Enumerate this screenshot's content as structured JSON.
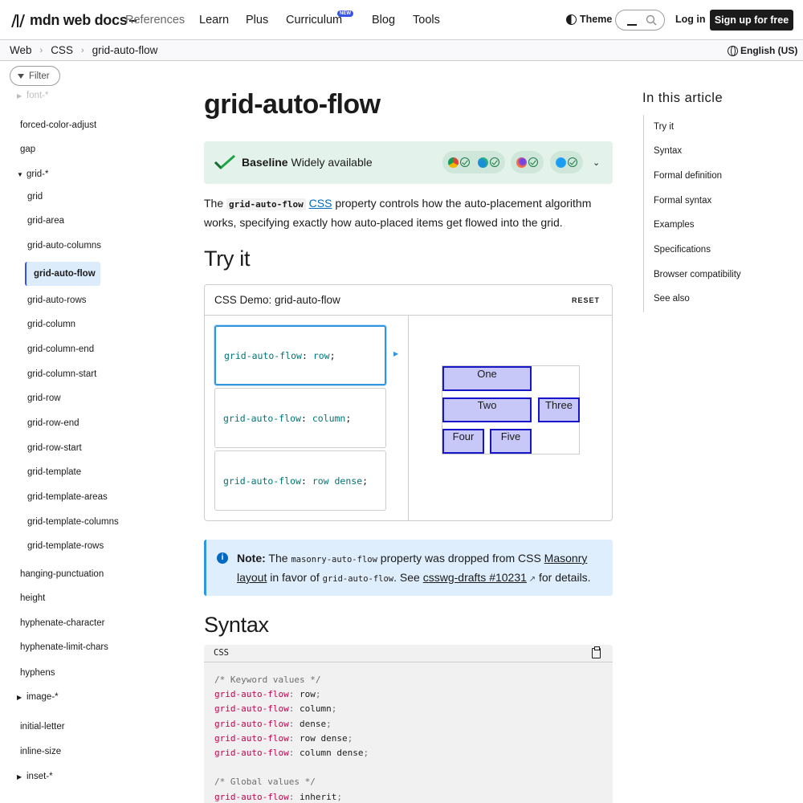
{
  "header": {
    "logo_text": "mdn web docs",
    "nav": [
      "References",
      "Learn",
      "Plus",
      "Curriculum",
      "Blog",
      "Tools"
    ],
    "new_badge": "NEW",
    "theme_label": "Theme",
    "login_label": "Log in",
    "signup_label": "Sign up for free"
  },
  "breadcrumb": {
    "items": [
      "Web",
      "CSS",
      "grid-auto-flow"
    ],
    "language": "English (US)"
  },
  "sidebar": {
    "filter_label": "Filter",
    "items": [
      {
        "label": "font-*",
        "faded": true
      },
      {
        "label": "forced-color-adjust"
      },
      {
        "label": "gap"
      },
      {
        "label": "grid-*"
      },
      {
        "label": "grid"
      },
      {
        "label": "grid-area"
      },
      {
        "label": "grid-auto-columns"
      },
      {
        "label": "grid-auto-flow",
        "active": true
      },
      {
        "label": "grid-auto-rows"
      },
      {
        "label": "grid-column"
      },
      {
        "label": "grid-column-end"
      },
      {
        "label": "grid-column-start"
      },
      {
        "label": "grid-row"
      },
      {
        "label": "grid-row-end"
      },
      {
        "label": "grid-row-start"
      },
      {
        "label": "grid-template"
      },
      {
        "label": "grid-template-areas"
      },
      {
        "label": "grid-template-columns"
      },
      {
        "label": "grid-template-rows"
      },
      {
        "label": "hanging-punctuation"
      },
      {
        "label": "height"
      },
      {
        "label": "hyphenate-character"
      },
      {
        "label": "hyphenate-limit-chars"
      },
      {
        "label": "hyphens"
      },
      {
        "label": "image-*"
      },
      {
        "label": "initial-letter"
      },
      {
        "label": "inline-size"
      },
      {
        "label": "inset-*"
      }
    ]
  },
  "main": {
    "title": "grid-auto-flow",
    "baseline": {
      "strong": "Baseline",
      "text": "Widely available"
    },
    "intro": {
      "before": "The",
      "code": "grid-auto-flow",
      "link": "CSS",
      "after": "property controls how the auto-placement algorithm works, specifying exactly how auto-placed items get flowed into the grid."
    },
    "try_it_heading": "Try it",
    "demo": {
      "title": "CSS Demo: grid-auto-flow",
      "reset_label": "RESET",
      "choices": [
        {
          "prop": "grid-auto-flow",
          "value": "row"
        },
        {
          "prop": "grid-auto-flow",
          "value": "column"
        },
        {
          "prop": "grid-auto-flow",
          "value": "row dense"
        }
      ],
      "cells": [
        "One",
        "Two",
        "Three",
        "Four",
        "Five"
      ]
    },
    "note": {
      "label": "Note:",
      "t1": "The",
      "c1": "masonry-auto-flow",
      "t2": "property was dropped from CSS",
      "link1": "Masonry layout",
      "t3": "in favor of",
      "c2": "grid-auto-flow",
      "t4": ". See",
      "link2": "csswg-drafts #10231",
      "t5": "for details."
    },
    "syntax_heading": "Syntax",
    "code": {
      "lang": "CSS",
      "lines": [
        {
          "comment": "/* Keyword values */"
        },
        {
          "prop": "grid-auto-flow",
          "value": "row"
        },
        {
          "prop": "grid-auto-flow",
          "value": "column"
        },
        {
          "prop": "grid-auto-flow",
          "value": "dense"
        },
        {
          "prop": "grid-auto-flow",
          "value": "row dense"
        },
        {
          "prop": "grid-auto-flow",
          "value": "column dense"
        },
        {
          "blank": true
        },
        {
          "comment": "/* Global values */"
        },
        {
          "prop": "grid-auto-flow",
          "value": "inherit"
        }
      ]
    }
  },
  "toc": {
    "title": "In this article",
    "items": [
      "Try it",
      "Syntax",
      "Formal definition",
      "Formal syntax",
      "Examples",
      "Specifications",
      "Browser compatibility",
      "See also"
    ]
  }
}
